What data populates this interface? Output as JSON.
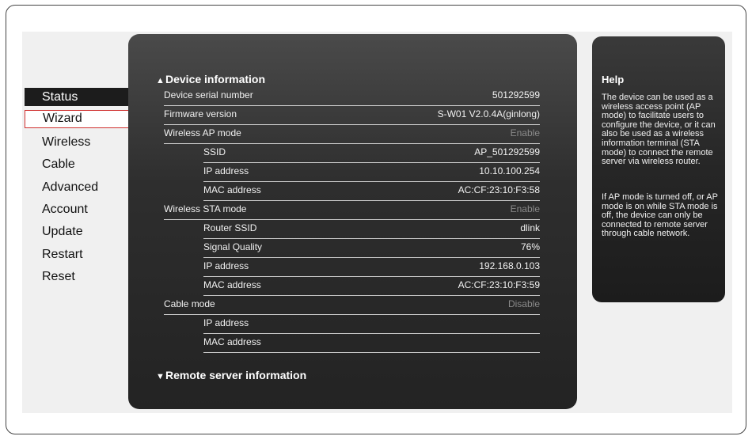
{
  "nav": [
    {
      "label": "Status"
    },
    {
      "label": "Wizard"
    },
    {
      "label": "Wireless"
    },
    {
      "label": "Cable"
    },
    {
      "label": "Advanced"
    },
    {
      "label": "Account"
    },
    {
      "label": "Update"
    },
    {
      "label": "Restart"
    },
    {
      "label": "Reset"
    }
  ],
  "device": {
    "title": "Device information",
    "rows": [
      {
        "label": "Device serial number",
        "value": "501292599"
      },
      {
        "label": "Firmware version",
        "value": "S-W01 V2.0.4A(ginlong)"
      },
      {
        "label": "Wireless AP mode",
        "value": "Enable"
      },
      {
        "label": "SSID",
        "value": "AP_501292599"
      },
      {
        "label": "IP address",
        "value": "10.10.100.254"
      },
      {
        "label": "MAC address",
        "value": "AC:CF:23:10:F3:58"
      },
      {
        "label": "Wireless STA mode",
        "value": "Enable"
      },
      {
        "label": "Router SSID",
        "value": "dlink"
      },
      {
        "label": "Signal Quality",
        "value": "76%"
      },
      {
        "label": "IP address",
        "value": "192.168.0.103"
      },
      {
        "label": "MAC address",
        "value": "AC:CF:23:10:F3:59"
      },
      {
        "label": "Cable mode",
        "value": "Disable"
      },
      {
        "label": "IP address",
        "value": ""
      },
      {
        "label": "MAC address",
        "value": ""
      }
    ]
  },
  "remote": {
    "title": "Remote server information"
  },
  "help": {
    "title": "Help",
    "p1": "The device can be used as a wireless access point (AP mode) to facilitate users to configure the device, or it can also be used as a wireless information terminal (STA mode) to connect the remote server via wireless router.",
    "p2": "If AP mode is turned off, or AP mode is on while STA mode is off, the device can only be connected to remote server through cable network."
  }
}
